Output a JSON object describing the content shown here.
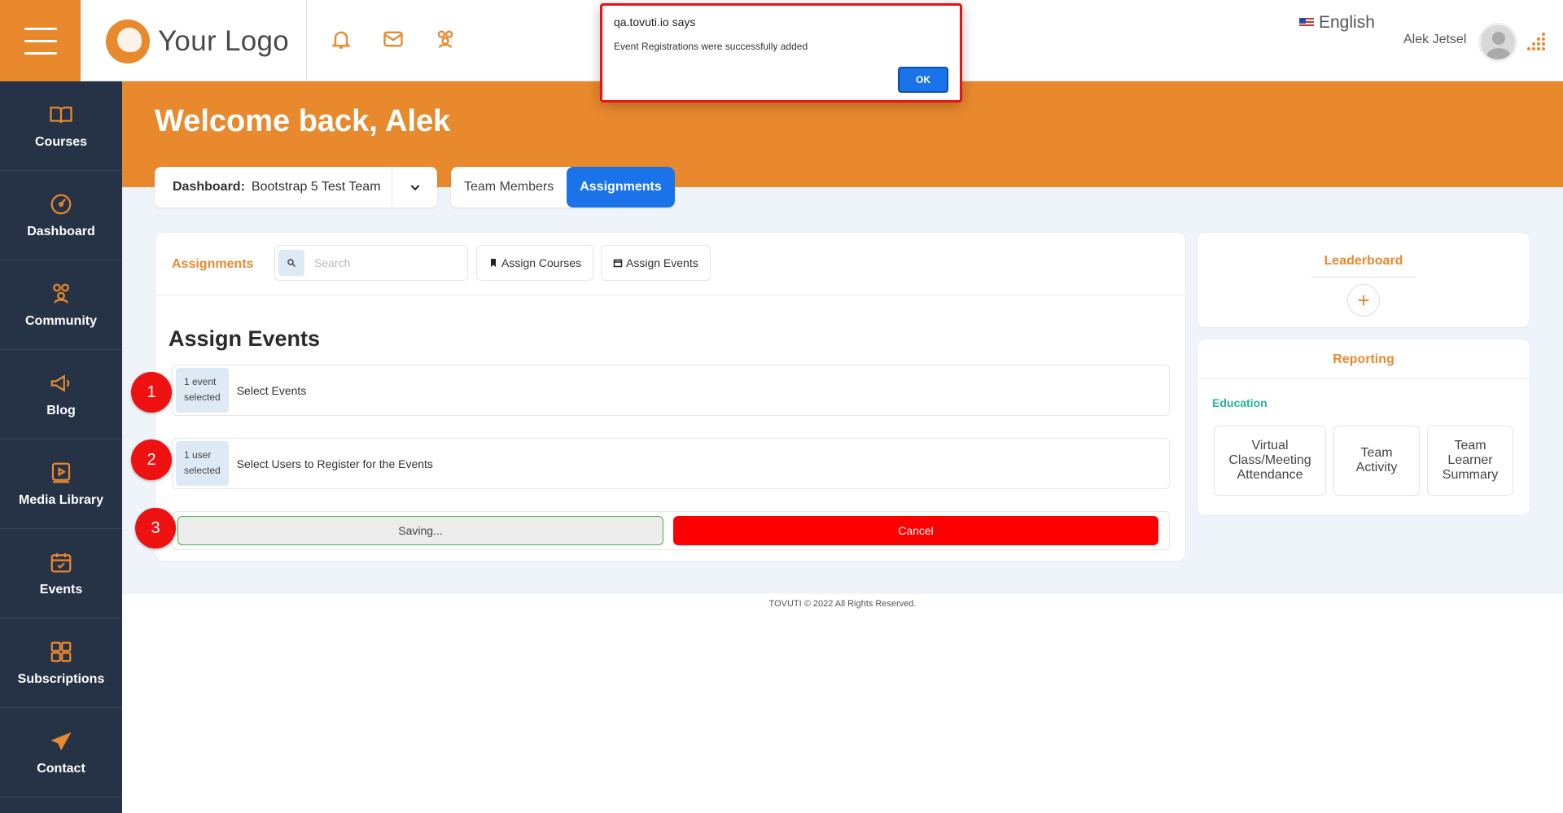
{
  "header": {
    "logo_text": "Your Logo",
    "language": "English",
    "user_name": "Alek Jetsel"
  },
  "sidebar": {
    "items": [
      {
        "label": "Courses",
        "icon": "book-icon"
      },
      {
        "label": "Dashboard",
        "icon": "gauge-icon"
      },
      {
        "label": "Community",
        "icon": "people-icon"
      },
      {
        "label": "Blog",
        "icon": "megaphone-icon"
      },
      {
        "label": "Media Library",
        "icon": "video-icon"
      },
      {
        "label": "Events",
        "icon": "calendar-icon"
      },
      {
        "label": "Subscriptions",
        "icon": "grid-icon"
      },
      {
        "label": "Contact",
        "icon": "paper-plane-icon"
      }
    ]
  },
  "hero": {
    "title": "Welcome back, Alek"
  },
  "dashboard_select": {
    "label": "Dashboard:",
    "value": "Bootstrap 5 Test Team"
  },
  "tabs": [
    {
      "label": "Team Members",
      "active": false
    },
    {
      "label": "Assignments",
      "active": true
    }
  ],
  "main": {
    "header_title": "Assignments",
    "search_placeholder": "Search",
    "assign_courses": "Assign Courses",
    "assign_events": "Assign Events",
    "section_title": "Assign Events",
    "step1": {
      "badge_line1": "1 event",
      "badge_line2": "selected",
      "text": "Select Events"
    },
    "step2": {
      "badge_line1": "1 user",
      "badge_line2": "selected",
      "text": "Select Users to Register for the Events"
    },
    "saving_label": "Saving...",
    "cancel_label": "Cancel",
    "markers": [
      "1",
      "2",
      "3"
    ]
  },
  "leaderboard": {
    "title": "Leaderboard",
    "add_symbol": "+"
  },
  "reporting": {
    "title": "Reporting",
    "category": "Education",
    "buttons": [
      "Virtual Class/Meeting Attendance",
      "Team Activity",
      "Team Learner Summary"
    ]
  },
  "footer": {
    "text": "TOVUTI © 2022 All Rights Reserved."
  },
  "dialog": {
    "title": "qa.tovuti.io says",
    "message": "Event Registrations were successfully added",
    "ok_label": "OK"
  },
  "colors": {
    "brand_orange": "#e8892e",
    "sidebar": "#263245",
    "primary_blue": "#1a73e8",
    "cancel_red": "#ff0000",
    "education_green": "#26b59a"
  }
}
